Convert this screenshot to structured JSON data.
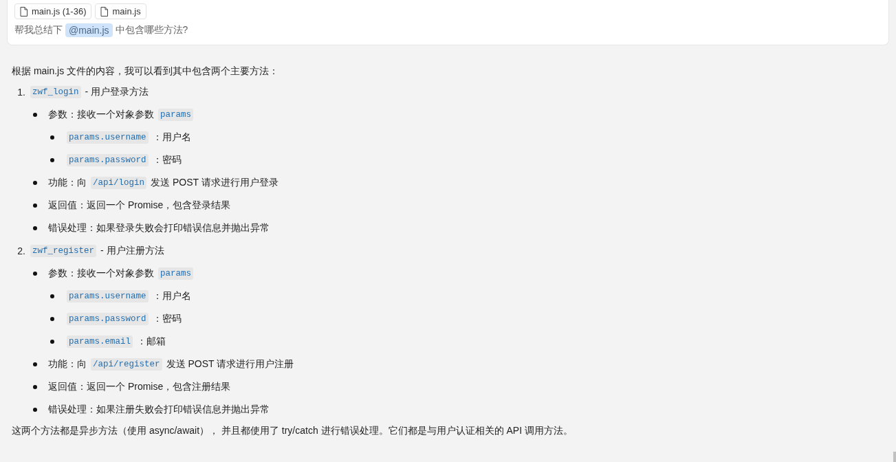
{
  "query": {
    "attachments": [
      {
        "label": "main.js (1-36)"
      },
      {
        "label": "main.js"
      }
    ],
    "parts": [
      {
        "kind": "text",
        "text": "帮我总结下"
      },
      {
        "kind": "mention",
        "text": "@main.js"
      },
      {
        "kind": "text",
        "text": "中包含哪些方法?"
      }
    ]
  },
  "answer": {
    "intro": "根据 main.js 文件的内容，我可以看到其中包含两个主要方法：",
    "methods": [
      {
        "number": "1.",
        "parts": [
          {
            "kind": "code",
            "text": "zwf_login"
          },
          {
            "kind": "text",
            "text": "- 用户登录方法"
          }
        ],
        "children": [
          {
            "parts": [
              {
                "kind": "text",
                "text": "参数：接收一个对象参数"
              },
              {
                "kind": "code",
                "text": "params"
              }
            ],
            "children": [
              {
                "parts": [
                  {
                    "kind": "code",
                    "text": "params.username"
                  },
                  {
                    "kind": "text",
                    "text": "：用户名"
                  }
                ]
              },
              {
                "parts": [
                  {
                    "kind": "code",
                    "text": "params.password"
                  },
                  {
                    "kind": "text",
                    "text": "：密码"
                  }
                ]
              }
            ]
          },
          {
            "parts": [
              {
                "kind": "text",
                "text": "功能：向"
              },
              {
                "kind": "code",
                "text": "/api/login"
              },
              {
                "kind": "text",
                "text": "发送 POST 请求进行用户登录"
              }
            ]
          },
          {
            "parts": [
              {
                "kind": "text",
                "text": "返回值：返回一个 Promise，包含登录结果"
              }
            ]
          },
          {
            "parts": [
              {
                "kind": "text",
                "text": "错误处理：如果登录失败会打印错误信息并抛出异常"
              }
            ]
          }
        ]
      },
      {
        "number": "2.",
        "parts": [
          {
            "kind": "code",
            "text": "zwf_register"
          },
          {
            "kind": "text",
            "text": "- 用户注册方法"
          }
        ],
        "children": [
          {
            "parts": [
              {
                "kind": "text",
                "text": "参数：接收一个对象参数"
              },
              {
                "kind": "code",
                "text": "params"
              }
            ],
            "children": [
              {
                "parts": [
                  {
                    "kind": "code",
                    "text": "params.username"
                  },
                  {
                    "kind": "text",
                    "text": "：用户名"
                  }
                ]
              },
              {
                "parts": [
                  {
                    "kind": "code",
                    "text": "params.password"
                  },
                  {
                    "kind": "text",
                    "text": "：密码"
                  }
                ]
              },
              {
                "parts": [
                  {
                    "kind": "code",
                    "text": "params.email"
                  },
                  {
                    "kind": "text",
                    "text": "：邮箱"
                  }
                ]
              }
            ]
          },
          {
            "parts": [
              {
                "kind": "text",
                "text": "功能：向"
              },
              {
                "kind": "code",
                "text": "/api/register"
              },
              {
                "kind": "text",
                "text": "发送 POST 请求进行用户注册"
              }
            ]
          },
          {
            "parts": [
              {
                "kind": "text",
                "text": "返回值：返回一个 Promise，包含注册结果"
              }
            ]
          },
          {
            "parts": [
              {
                "kind": "text",
                "text": "错误处理：如果注册失败会打印错误信息并抛出异常"
              }
            ]
          }
        ]
      }
    ],
    "conclusion": "这两个方法都是异步方法（使用 async/await）， 并且都使用了 try/catch 进行错误处理。它们都是与用户认证相关的 API 调用方法。"
  }
}
